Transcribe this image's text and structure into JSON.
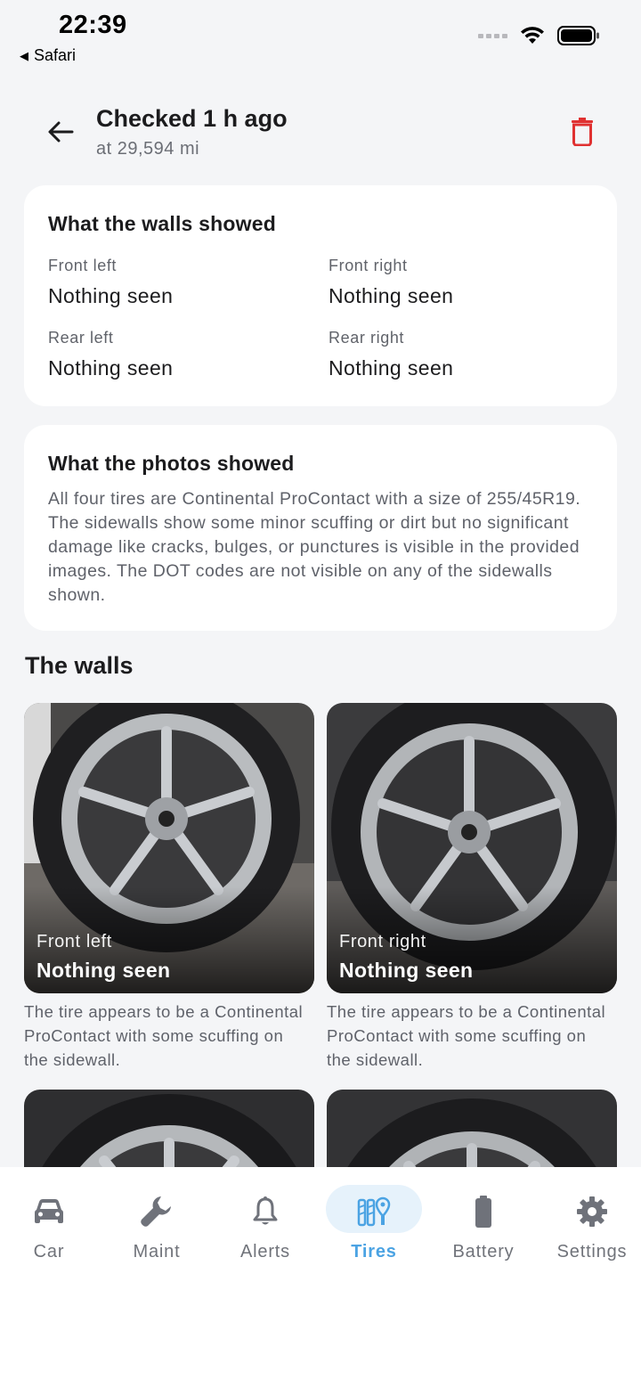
{
  "status_bar": {
    "time": "22:39",
    "back_app": "Safari"
  },
  "header": {
    "title": "Checked 1 h ago",
    "subtitle": "at 29,594 mi"
  },
  "walls_card": {
    "title": "What the walls showed",
    "items": [
      {
        "label": "Front left",
        "value": "Nothing seen"
      },
      {
        "label": "Front right",
        "value": "Nothing seen"
      },
      {
        "label": "Rear left",
        "value": "Nothing seen"
      },
      {
        "label": "Rear right",
        "value": "Nothing seen"
      }
    ]
  },
  "photos_card": {
    "title": "What the photos showed",
    "body": "All four tires are Continental ProContact with a size of 255/45R19. The sidewalls show some minor scuffing or dirt but no significant damage like cracks, bulges, or punctures is visible in the provided images. The DOT codes are not visible on any of the sidewalls shown."
  },
  "walls_section": {
    "title": "The walls",
    "tiles": [
      {
        "position": "Front left",
        "status": "Nothing seen",
        "note": "The tire appears to be a Continental ProContact with some scuffing on the sidewall."
      },
      {
        "position": "Front right",
        "status": "Nothing seen",
        "note": "The tire appears to be a Continental ProContact with some scuffing on the sidewall."
      },
      {
        "position": "",
        "status": "",
        "note": ""
      },
      {
        "position": "",
        "status": "",
        "note": ""
      }
    ]
  },
  "nav": {
    "active": "Tires",
    "accent_color": "#4ba3e3",
    "delete_color": "#e03131",
    "items": [
      {
        "label": "Car",
        "icon": "car-icon"
      },
      {
        "label": "Maint",
        "icon": "wrench-icon"
      },
      {
        "label": "Alerts",
        "icon": "bell-icon"
      },
      {
        "label": "Tires",
        "icon": "tire-icon"
      },
      {
        "label": "Battery",
        "icon": "battery-icon"
      },
      {
        "label": "Settings",
        "icon": "gear-icon"
      }
    ]
  }
}
